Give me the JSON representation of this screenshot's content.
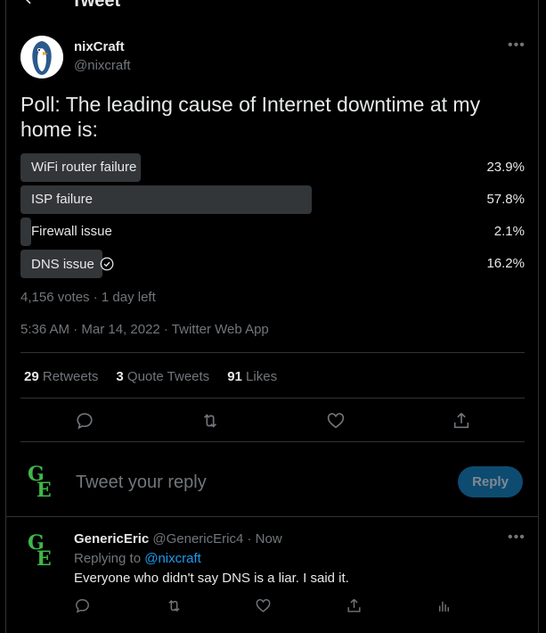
{
  "header": {
    "title": "Tweet"
  },
  "tweet": {
    "author_name": "nixCraft",
    "author_handle": "@nixcraft",
    "text": "Poll: The leading cause of Internet downtime at my home is:",
    "poll": {
      "options": [
        {
          "label": "WiFi router failure",
          "percent_text": "23.9%",
          "percent": 23.9,
          "winner": false
        },
        {
          "label": "ISP failure",
          "percent_text": "57.8%",
          "percent": 57.8,
          "winner": true
        },
        {
          "label": "Firewall issue",
          "percent_text": "2.1%",
          "percent": 2.1,
          "winner": false
        },
        {
          "label": "DNS issue",
          "percent_text": "16.2%",
          "percent": 16.2,
          "winner": false,
          "voted": true
        }
      ],
      "summary": "4,156 votes · 1 day left"
    },
    "timestamp": "5:36 AM · Mar 14, 2022 · Twitter Web App",
    "stats": {
      "retweets_count": "29",
      "retweets_label": "Retweets",
      "quotes_count": "3",
      "quotes_label": "Quote Tweets",
      "likes_count": "91",
      "likes_label": "Likes"
    },
    "actions": [
      "reply-icon",
      "retweet-icon",
      "like-icon",
      "share-icon"
    ]
  },
  "composer": {
    "placeholder": "Tweet your reply",
    "button_label": "Reply"
  },
  "replies": [
    {
      "name": "GenericEric",
      "handle": "@GenericEric4",
      "time": "Now",
      "replying_to_label": "Replying to",
      "replying_to_handle": "@nixcraft",
      "text": "Everyone who didn't say DNS is a liar. I said it."
    }
  ],
  "colors": {
    "background": "#000000",
    "text": "#e7e9ea",
    "muted": "#71767b",
    "accent": "#1d9bf0",
    "poll_bar": "#333639",
    "reply_button": "#0e4b71"
  }
}
